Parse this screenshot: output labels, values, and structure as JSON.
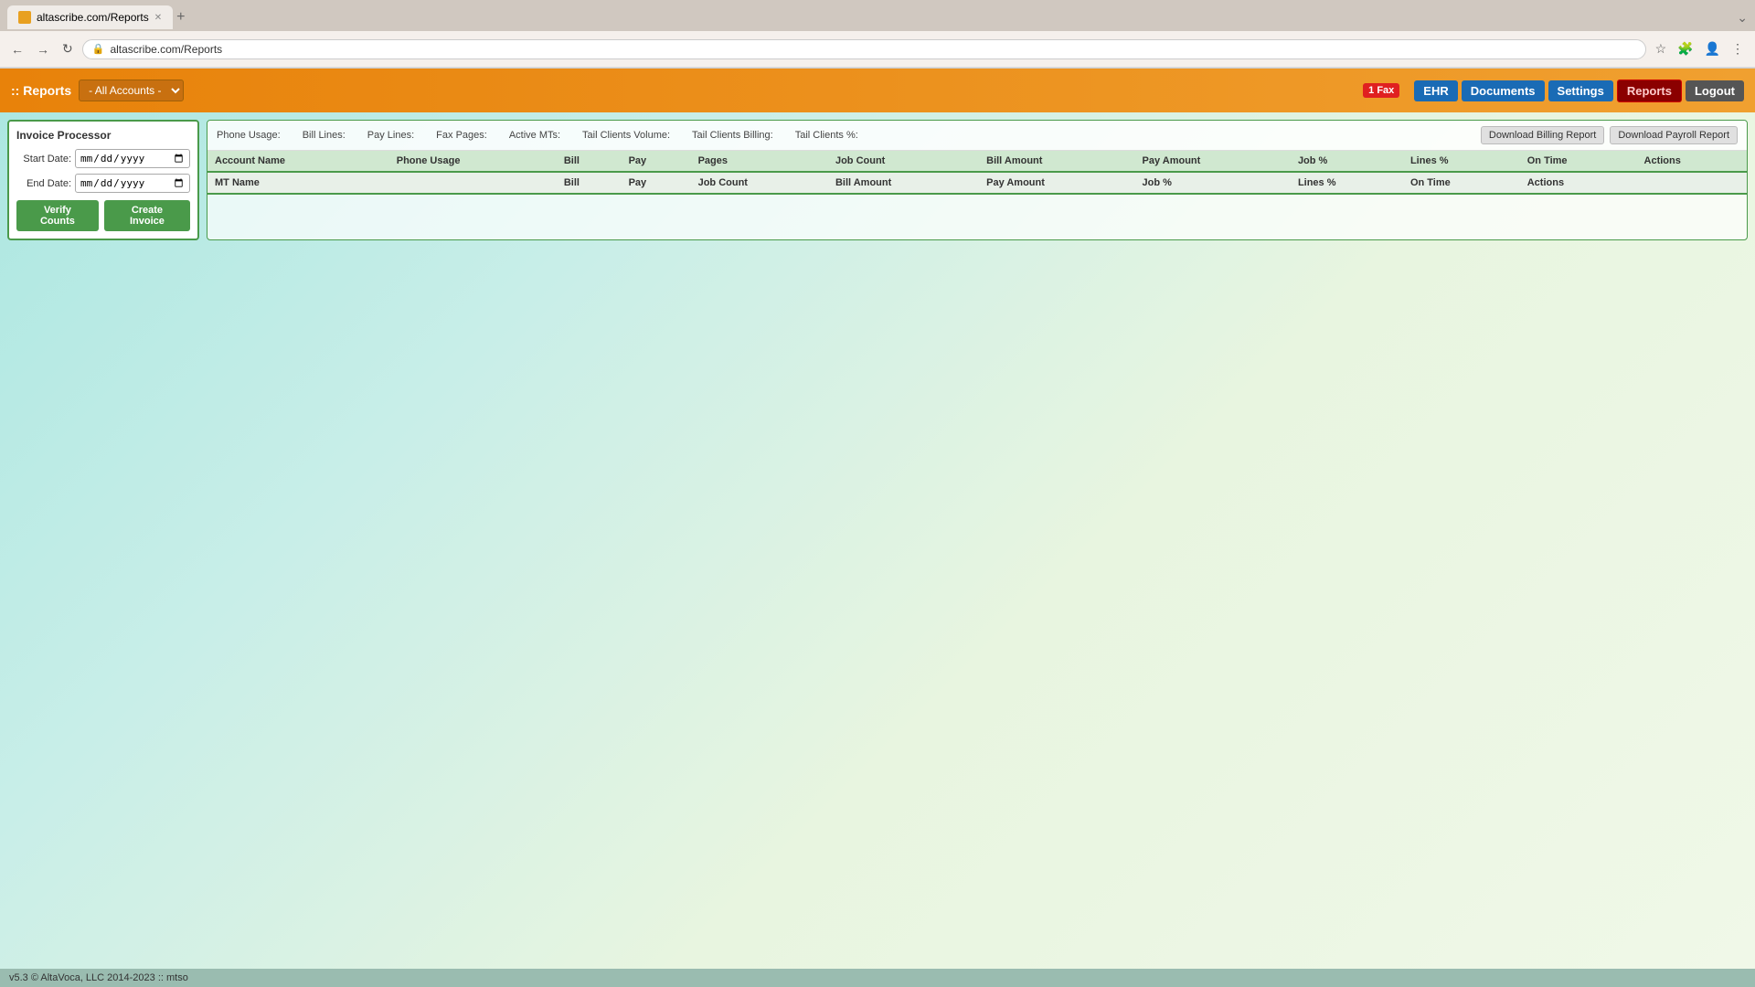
{
  "browser": {
    "tab_title": "altascribe.com/Reports",
    "tab_icon": "🅰",
    "address": "altascribe.com/Reports",
    "new_tab_label": "+",
    "expand_label": "⌄",
    "back_label": "←",
    "forward_label": "→",
    "reload_label": "↻",
    "lock_label": "🔒",
    "bookmark_label": "☆",
    "extensions_label": "🧩",
    "profile_label": "👤",
    "menu_label": "⋮"
  },
  "toolbar": {
    "reports_label": ":: Reports",
    "account_select_value": "- All Accounts -",
    "fax_badge": "1 Fax",
    "nav_items": [
      {
        "label": "EHR",
        "key": "ehr"
      },
      {
        "label": "Documents",
        "key": "documents"
      },
      {
        "label": "Settings",
        "key": "settings"
      },
      {
        "label": "Reports",
        "key": "reports"
      },
      {
        "label": "Logout",
        "key": "logout"
      }
    ]
  },
  "left_panel": {
    "title": "Invoice Processor",
    "start_date_label": "Start Date:",
    "start_date_placeholder": "mm/dd/yyyy",
    "end_date_label": "End Date:",
    "end_date_placeholder": "mm/dd/yyyy",
    "verify_btn": "Verify Counts",
    "create_btn": "Create Invoice"
  },
  "stats_bar": {
    "phone_usage_label": "Phone Usage:",
    "bill_lines_label": "Bill Lines:",
    "pay_lines_label": "Pay Lines:",
    "fax_pages_label": "Fax Pages:",
    "active_mts_label": "Active MTs:",
    "tail_clients_volume_label": "Tail Clients Volume:",
    "tail_clients_billing_label": "Tail Clients Billing:",
    "tail_clients_pct_label": "Tail Clients %:",
    "download_billing_btn": "Download Billing Report",
    "download_payroll_btn": "Download Payroll Report"
  },
  "main_table": {
    "headers": [
      "Account Name",
      "Phone Usage",
      "Bill",
      "Pay",
      "Pages",
      "Job Count",
      "Bill Amount",
      "Pay Amount",
      "Job %",
      "Lines %",
      "On Time",
      "Actions"
    ],
    "subheaders": [
      "MT Name",
      "Bill",
      "Pay",
      "Job Count",
      "Bill Amount",
      "Pay Amount",
      "Job %",
      "Lines %",
      "On Time",
      "Actions"
    ]
  },
  "footer": {
    "text": "v5.3 © AltaVoca, LLC 2014-2023 :: mtso"
  }
}
